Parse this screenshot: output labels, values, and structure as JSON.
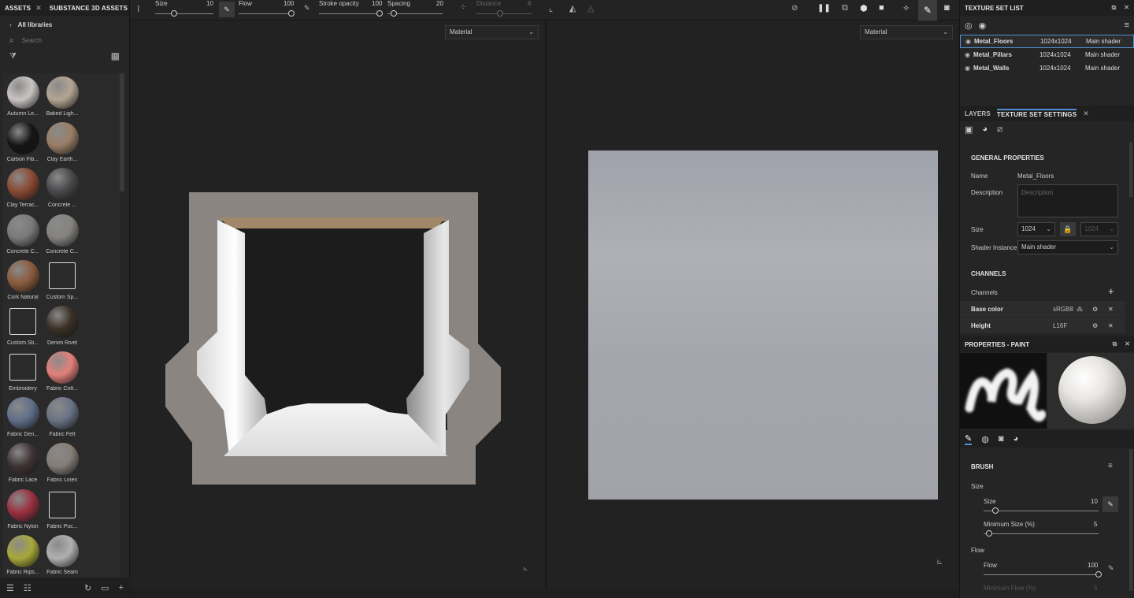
{
  "assets_panel": {
    "tab_assets": "ASSETS",
    "tab_substance": "SUBSTANCE 3D ASSETS",
    "all_libraries": "All libraries",
    "search_placeholder": "Search",
    "materials": [
      {
        "label": "Autumn Le...",
        "color": "#c9c4c2"
      },
      {
        "label": "Baked Ligh...",
        "color": "#b3a593"
      },
      {
        "label": "Carbon Fib...",
        "color": "#151515"
      },
      {
        "label": "Clay Earth...",
        "color": "#9a7e66"
      },
      {
        "label": "Clay Terrac...",
        "color": "#8a4a33"
      },
      {
        "label": "Concrete ...",
        "color": "#4a4a4d"
      },
      {
        "label": "Concrete C...",
        "color": "#7a7a7a"
      },
      {
        "label": "Concrete C...",
        "color": "#858380"
      },
      {
        "label": "Cork Natural",
        "color": "#8a5a3c"
      },
      {
        "label": "Custom Sp...",
        "color": "#2a2a2a"
      },
      {
        "label": "Custom Sti...",
        "color": "#2a2a2a"
      },
      {
        "label": "Denim Rivet",
        "color": "#3a3026"
      },
      {
        "label": "Embroidery",
        "color": "#2a2a2a"
      },
      {
        "label": "Fabric Cott...",
        "color": "#e3807a"
      },
      {
        "label": "Fabric Den...",
        "color": "#5f6f8a"
      },
      {
        "label": "Fabric Felt",
        "color": "#6a7385"
      },
      {
        "label": "Fabric Lace",
        "color": "#3f3335"
      },
      {
        "label": "Fabric Linen",
        "color": "#857d76"
      },
      {
        "label": "Fabric Nylon",
        "color": "#9a3040"
      },
      {
        "label": "Fabric Puc...",
        "color": "#2a2a2a"
      },
      {
        "label": "Fabric Rips...",
        "color": "#a8a83a"
      },
      {
        "label": "Fabric Seam",
        "color": "#b0b0b0"
      }
    ]
  },
  "toolbar": {
    "size_label": "Size",
    "size_value": "10",
    "flow_label": "Flow",
    "flow_value": "100",
    "stroke_opacity_label": "Stroke opacity",
    "stroke_opacity_value": "100",
    "spacing_label": "Spacing",
    "spacing_value": "20",
    "distance_label": "Distance",
    "distance_value": "8"
  },
  "viewport3d": {
    "mode": "Material"
  },
  "viewport2d": {
    "mode": "Material"
  },
  "texture_set_list": {
    "title": "TEXTURE SET LIST",
    "rows": [
      {
        "name": "Metal_Floors",
        "size": "1024x1024",
        "shader": "Main shader"
      },
      {
        "name": "Metal_Pillars",
        "size": "1024x1024",
        "shader": "Main shader"
      },
      {
        "name": "Metal_Walls",
        "size": "1024x1024",
        "shader": "Main shader"
      }
    ]
  },
  "settings_panel": {
    "tab_layers": "LAYERS",
    "tab_settings": "TEXTURE SET SETTINGS",
    "general_properties": "GENERAL PROPERTIES",
    "name_label": "Name",
    "name_value": "Metal_Floors",
    "description_label": "Description",
    "description_placeholder": "Description",
    "size_label": "Size",
    "size_value": "1024",
    "size_value_locked": "1024",
    "shader_label": "Shader Instance",
    "shader_value": "Main shader",
    "channels_head": "CHANNELS",
    "channels_label": "Channels",
    "channel_rows": [
      {
        "name": "Base color",
        "format": "sRGB8"
      },
      {
        "name": "Height",
        "format": "L16F"
      }
    ]
  },
  "properties_paint": {
    "title": "PROPERTIES - PAINT",
    "brush_head": "BRUSH",
    "size_group": "Size",
    "size_label": "Size",
    "size_value": "10",
    "size_fraction": 0.1,
    "min_size_label": "Minimum Size (%)",
    "min_size_value": "5",
    "min_size_fraction": 0.05,
    "flow_group": "Flow",
    "flow_label": "Flow",
    "flow_value": "100",
    "flow_fraction": 1.0,
    "min_flow_label": "Minimum Flow (%)",
    "min_flow_value": "5"
  }
}
